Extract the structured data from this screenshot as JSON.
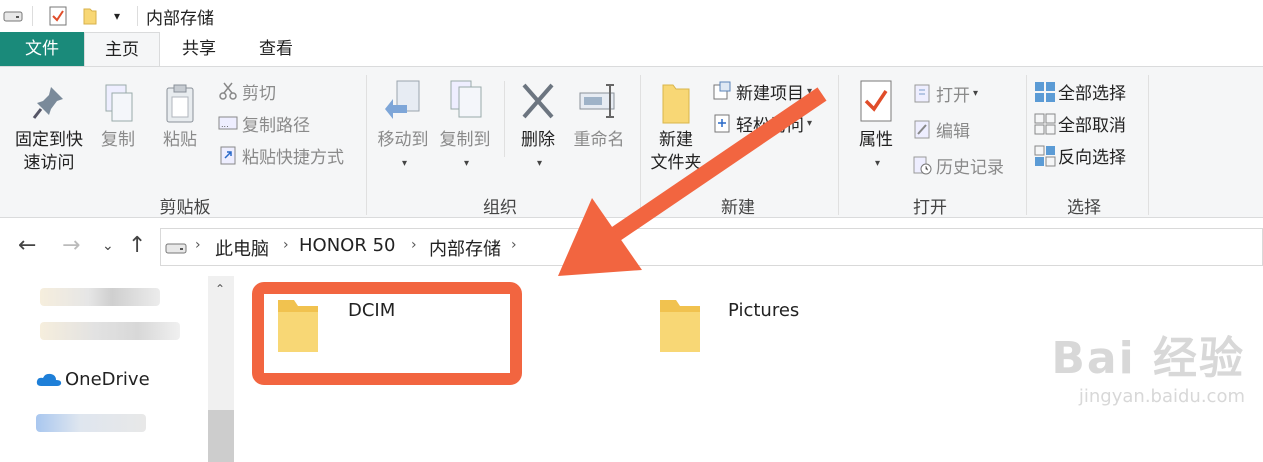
{
  "window": {
    "title": "内部存储"
  },
  "tabs": [
    {
      "label": "文件"
    },
    {
      "label": "主页"
    },
    {
      "label": "共享"
    },
    {
      "label": "查看"
    }
  ],
  "ribbon": {
    "clipboard": {
      "group_label": "剪贴板",
      "pin_line1": "固定到快",
      "pin_line2": "速访问",
      "copy": "复制",
      "paste": "粘贴",
      "cut": "剪切",
      "copy_path": "复制路径",
      "paste_shortcut": "粘贴快捷方式"
    },
    "organize": {
      "group_label": "组织",
      "move_to": "移动到",
      "copy_to": "复制到",
      "delete": "删除",
      "rename": "重命名"
    },
    "new": {
      "group_label": "新建",
      "new_folder_line1": "新建",
      "new_folder_line2": "文件夹",
      "new_item": "新建项目",
      "easy_access": "轻松访问"
    },
    "open": {
      "group_label": "打开",
      "properties": "属性",
      "open": "打开",
      "edit": "编辑",
      "history": "历史记录"
    },
    "select": {
      "group_label": "选择",
      "select_all": "全部选择",
      "select_none": "全部取消",
      "invert": "反向选择"
    }
  },
  "address": {
    "crumbs": [
      "此电脑",
      "HONOR 50",
      "内部存储"
    ]
  },
  "nav_pane": {
    "onedrive": "OneDrive"
  },
  "files": [
    {
      "name": "DCIM",
      "icon": "folder-icon"
    },
    {
      "name": "Pictures",
      "icon": "folder-icon"
    }
  ],
  "annotation": {
    "color": "#f26540"
  },
  "watermark": {
    "brand": "Bai  经验",
    "url": "jingyan.baidu.com"
  },
  "colors": {
    "file_tab": "#1a8a7a",
    "folder": "#f8d775",
    "accent": "#f26540"
  }
}
